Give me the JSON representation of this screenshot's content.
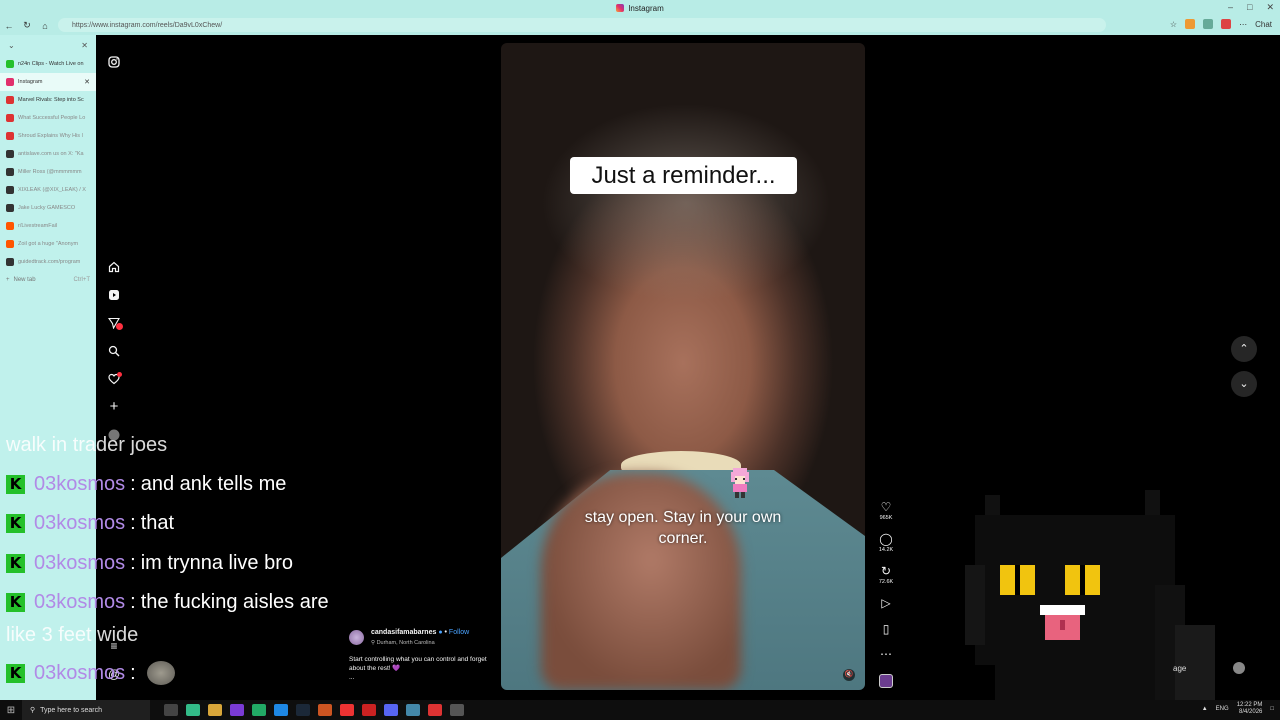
{
  "window": {
    "title": "Instagram"
  },
  "address_bar": {
    "url": "https://www.instagram.com/reels/Da9vL0xChew/"
  },
  "toolbar": {
    "chat_label": "Chat"
  },
  "tabs": [
    {
      "title": "n24n Clips - Watch Live on",
      "color": "#24c02a"
    },
    {
      "title": "Instagram",
      "color": "#e1306c",
      "active": true
    },
    {
      "title": "Marvel Rivals: Step into Sc",
      "color": "#d33"
    },
    {
      "title": "What Successful People Lo",
      "color": "#d33"
    },
    {
      "title": "Shroud Explains Why His l",
      "color": "#d33"
    },
    {
      "title": "antislave.com us on X: \"Ka",
      "color": "#333"
    },
    {
      "title": "Miller Ross (@mmmmmm",
      "color": "#333"
    },
    {
      "title": "XIXLEAK (@XIX_LEAK) / X",
      "color": "#333"
    },
    {
      "title": "Jake Lucky GAMESCO",
      "color": "#333"
    },
    {
      "title": "r/LivestreamFail",
      "color": "#f50"
    },
    {
      "title": "Zoil got a huge \"Anonym",
      "color": "#f50"
    },
    {
      "title": "guidedtrack.com/program",
      "color": "#333"
    }
  ],
  "new_tab": {
    "label": "New tab",
    "shortcut": "Ctrl+T"
  },
  "reel": {
    "caption_top": "Just a reminder...",
    "caption_sub": "stay open. Stay in your own corner.",
    "author": "candasifamabarnes",
    "follow_label": "Follow",
    "location": "Durham, North Carolina",
    "description": "Start controlling what you can control and forget about the rest! 💜",
    "more": "...",
    "likes": "965K",
    "comments": "14.2K",
    "reposts": "72.6K"
  },
  "chat": {
    "lines": [
      {
        "type": "plain",
        "text": "walk in trader joes"
      },
      {
        "type": "msg",
        "user": "03kosmos",
        "text": "and ank tells me"
      },
      {
        "type": "msg",
        "user": "03kosmos",
        "text": "that"
      },
      {
        "type": "msg",
        "user": "03kosmos",
        "text": "im trynna live bro"
      },
      {
        "type": "msg",
        "user": "03kosmos",
        "text": "the fucking aisles are"
      },
      {
        "type": "plain",
        "text": "like 3 feet wide"
      },
      {
        "type": "emote",
        "user": "03kosmos",
        "text": ""
      }
    ],
    "kick_glyph": "K",
    "separator": ":"
  },
  "overlay": {
    "partial_text": "age"
  },
  "taskbar": {
    "search_placeholder": "Type here to search",
    "lang": "ENG",
    "time": "12:22 PM",
    "date": "8/4/2026"
  },
  "colors": {
    "kick_green": "#24c02a",
    "username_purple": "#b18ae6",
    "tab_bg": "#c0f1ec"
  }
}
